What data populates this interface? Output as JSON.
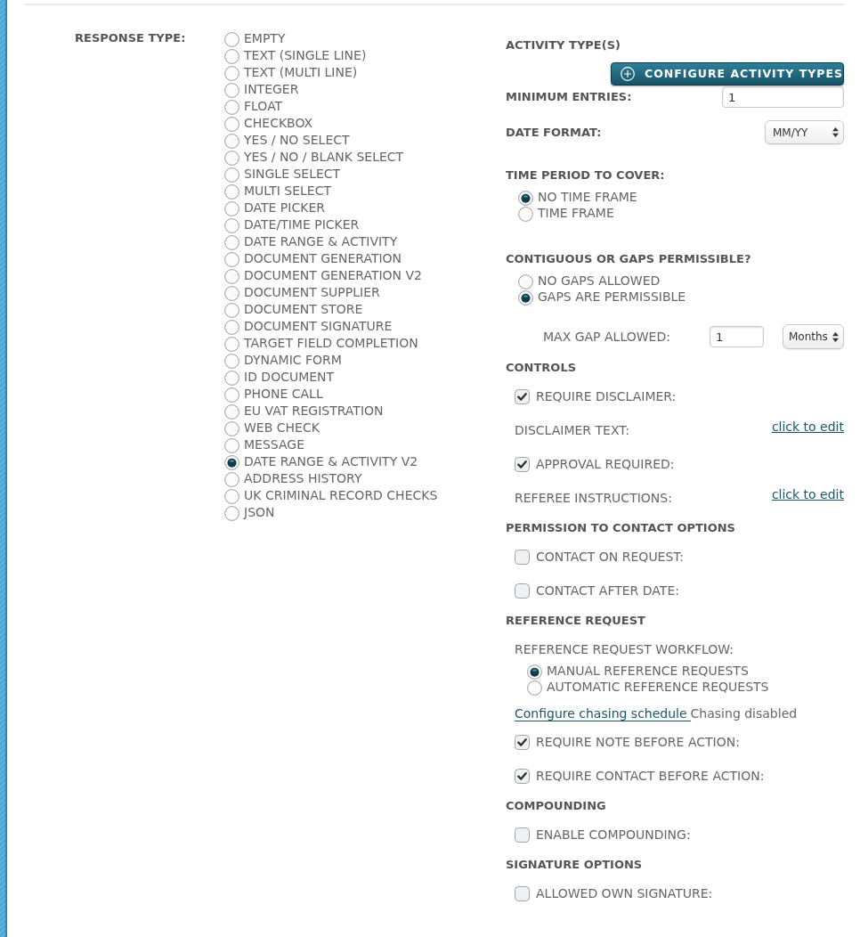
{
  "response_type": {
    "label": "RESPONSE TYPE:",
    "options": [
      {
        "label": "EMPTY",
        "selected": false
      },
      {
        "label": "TEXT (SINGLE LINE)",
        "selected": false
      },
      {
        "label": "TEXT (MULTI LINE)",
        "selected": false
      },
      {
        "label": "INTEGER",
        "selected": false
      },
      {
        "label": "FLOAT",
        "selected": false
      },
      {
        "label": "CHECKBOX",
        "selected": false
      },
      {
        "label": "YES / NO SELECT",
        "selected": false
      },
      {
        "label": "YES / NO / BLANK SELECT",
        "selected": false
      },
      {
        "label": "SINGLE SELECT",
        "selected": false
      },
      {
        "label": "MULTI SELECT",
        "selected": false
      },
      {
        "label": "DATE PICKER",
        "selected": false
      },
      {
        "label": "DATE/TIME PICKER",
        "selected": false
      },
      {
        "label": "DATE RANGE & ACTIVITY",
        "selected": false
      },
      {
        "label": "DOCUMENT GENERATION",
        "selected": false
      },
      {
        "label": "DOCUMENT GENERATION V2",
        "selected": false
      },
      {
        "label": "DOCUMENT SUPPLIER",
        "selected": false
      },
      {
        "label": "DOCUMENT STORE",
        "selected": false
      },
      {
        "label": "DOCUMENT SIGNATURE",
        "selected": false
      },
      {
        "label": "TARGET FIELD COMPLETION",
        "selected": false
      },
      {
        "label": "DYNAMIC FORM",
        "selected": false
      },
      {
        "label": "ID DOCUMENT",
        "selected": false
      },
      {
        "label": "PHONE CALL",
        "selected": false
      },
      {
        "label": "EU VAT REGISTRATION",
        "selected": false
      },
      {
        "label": "WEB CHECK",
        "selected": false
      },
      {
        "label": "MESSAGE",
        "selected": false
      },
      {
        "label": "DATE RANGE & ACTIVITY V2",
        "selected": true
      },
      {
        "label": "ADDRESS HISTORY",
        "selected": false
      },
      {
        "label": "UK CRIMINAL RECORD CHECKS",
        "selected": false
      },
      {
        "label": "JSON",
        "selected": false
      }
    ]
  },
  "activity_types": {
    "heading": "ACTIVITY TYPE(S)",
    "button": "CONFIGURE ACTIVITY TYPES",
    "minimum_entries": {
      "label": "MINIMUM ENTRIES:",
      "value": "1"
    },
    "date_format": {
      "label": "DATE FORMAT:",
      "value": "MM/YY"
    }
  },
  "time_period": {
    "heading": "TIME PERIOD TO COVER:",
    "options": [
      {
        "label": "NO TIME FRAME",
        "selected": true
      },
      {
        "label": "TIME FRAME",
        "selected": false
      }
    ]
  },
  "gaps": {
    "heading": "CONTIGUOUS OR GAPS PERMISSIBLE?",
    "options": [
      {
        "label": "NO GAPS ALLOWED",
        "selected": false
      },
      {
        "label": "GAPS ARE PERMISSIBLE",
        "selected": true
      }
    ],
    "max_gap": {
      "label": "MAX GAP ALLOWED:",
      "value": "1",
      "unit": "Months"
    }
  },
  "controls": {
    "heading": "CONTROLS",
    "items": [
      {
        "kind": "checkbox",
        "label": "REQUIRE DISCLAIMER:",
        "checked": true
      },
      {
        "kind": "edit",
        "label": "DISCLAIMER TEXT:",
        "link": "click to edit"
      },
      {
        "kind": "checkbox",
        "label": "APPROVAL REQUIRED:",
        "checked": true
      },
      {
        "kind": "edit",
        "label": "REFEREE INSTRUCTIONS:",
        "link": "click to edit"
      }
    ]
  },
  "permission_to_contact": {
    "heading": "PERMISSION TO CONTACT OPTIONS",
    "items": [
      {
        "label": "CONTACT ON REQUEST:",
        "checked": false
      },
      {
        "label": "CONTACT AFTER DATE:",
        "checked": false
      }
    ]
  },
  "reference_request": {
    "heading": "REFERENCE REQUEST",
    "workflow": {
      "label": "REFERENCE REQUEST WORKFLOW:",
      "options": [
        {
          "label": "MANUAL REFERENCE REQUESTS",
          "selected": true
        },
        {
          "label": "AUTOMATIC REFERENCE REQUESTS",
          "selected": false
        }
      ]
    },
    "chasing": {
      "link": "Configure chasing schedule",
      "status": "Chasing disabled"
    },
    "items": [
      {
        "label": "REQUIRE NOTE BEFORE ACTION:",
        "checked": true
      },
      {
        "label": "REQUIRE CONTACT BEFORE ACTION:",
        "checked": true
      }
    ]
  },
  "compounding": {
    "heading": "COMPOUNDING",
    "items": [
      {
        "label": "ENABLE COMPOUNDING:",
        "checked": false
      }
    ]
  },
  "signature_options": {
    "heading": "SIGNATURE OPTIONS",
    "items": [
      {
        "label": "ALLOWED OWN SIGNATURE:",
        "checked": false
      }
    ]
  }
}
